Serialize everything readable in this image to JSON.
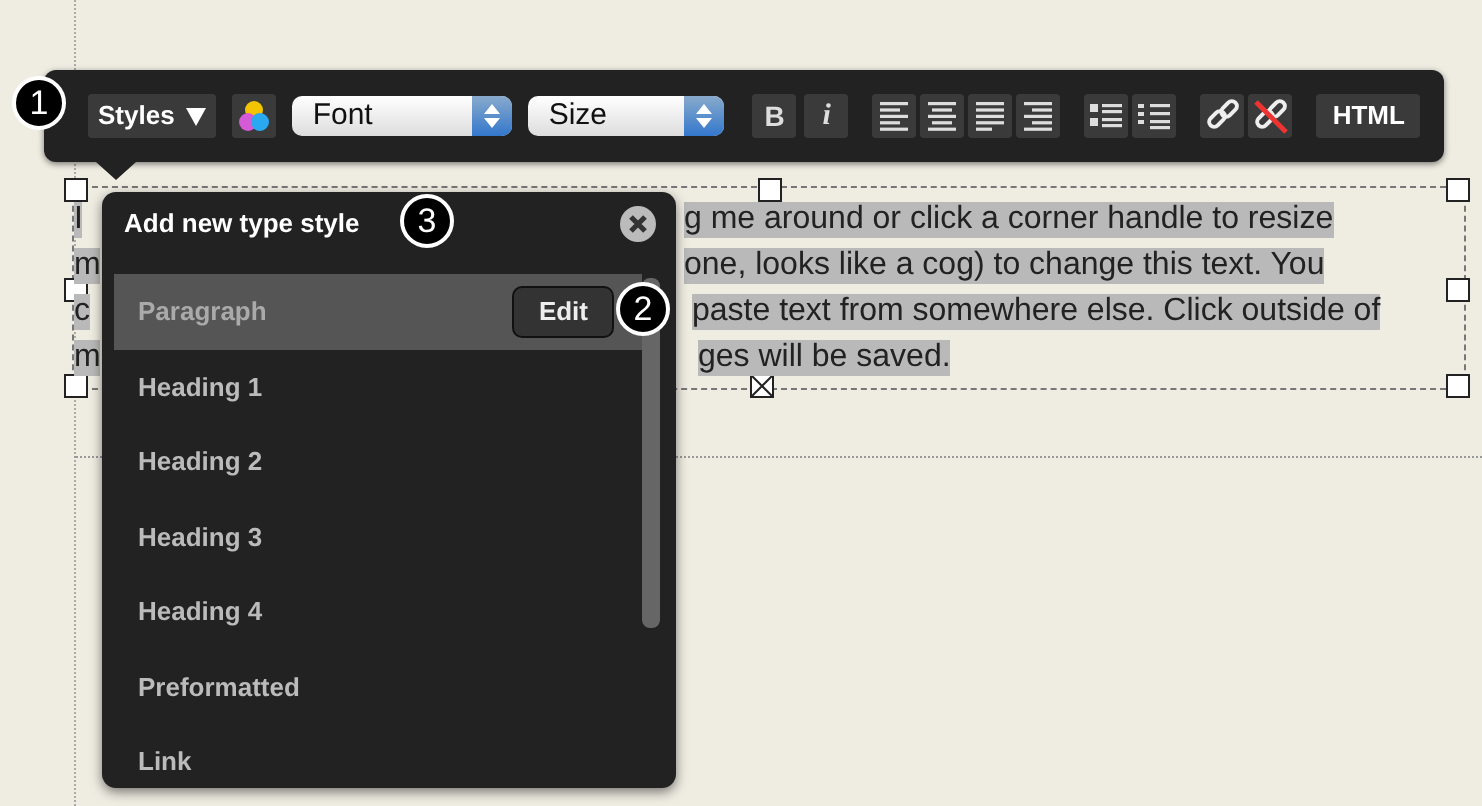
{
  "toolbar": {
    "styles_label": "Styles",
    "font_select": "Font",
    "size_select": "Size",
    "bold": "B",
    "italic": "i",
    "html_button": "HTML"
  },
  "callouts": [
    "1",
    "2",
    "3"
  ],
  "text_block": {
    "highlighted": true,
    "lines": [
      {
        "left": "I",
        "right": "g me around or click a corner handle to resize"
      },
      {
        "left": "m",
        "right": "one, looks like a cog) to change this text. You"
      },
      {
        "left": "c",
        "right": "paste text from somewhere else. Click outside of"
      },
      {
        "left": "m",
        "right": "ges will be saved."
      }
    ]
  },
  "style_menu": {
    "title": "Add new type style",
    "items": [
      {
        "label": "Paragraph",
        "selected": true,
        "action": "Edit"
      },
      {
        "label": "Heading 1",
        "selected": false
      },
      {
        "label": "Heading 2",
        "selected": false
      },
      {
        "label": "Heading 3",
        "selected": false
      },
      {
        "label": "Heading 4",
        "selected": false
      },
      {
        "label": "Preformatted",
        "selected": false
      },
      {
        "label": "Link",
        "selected": false
      }
    ]
  }
}
